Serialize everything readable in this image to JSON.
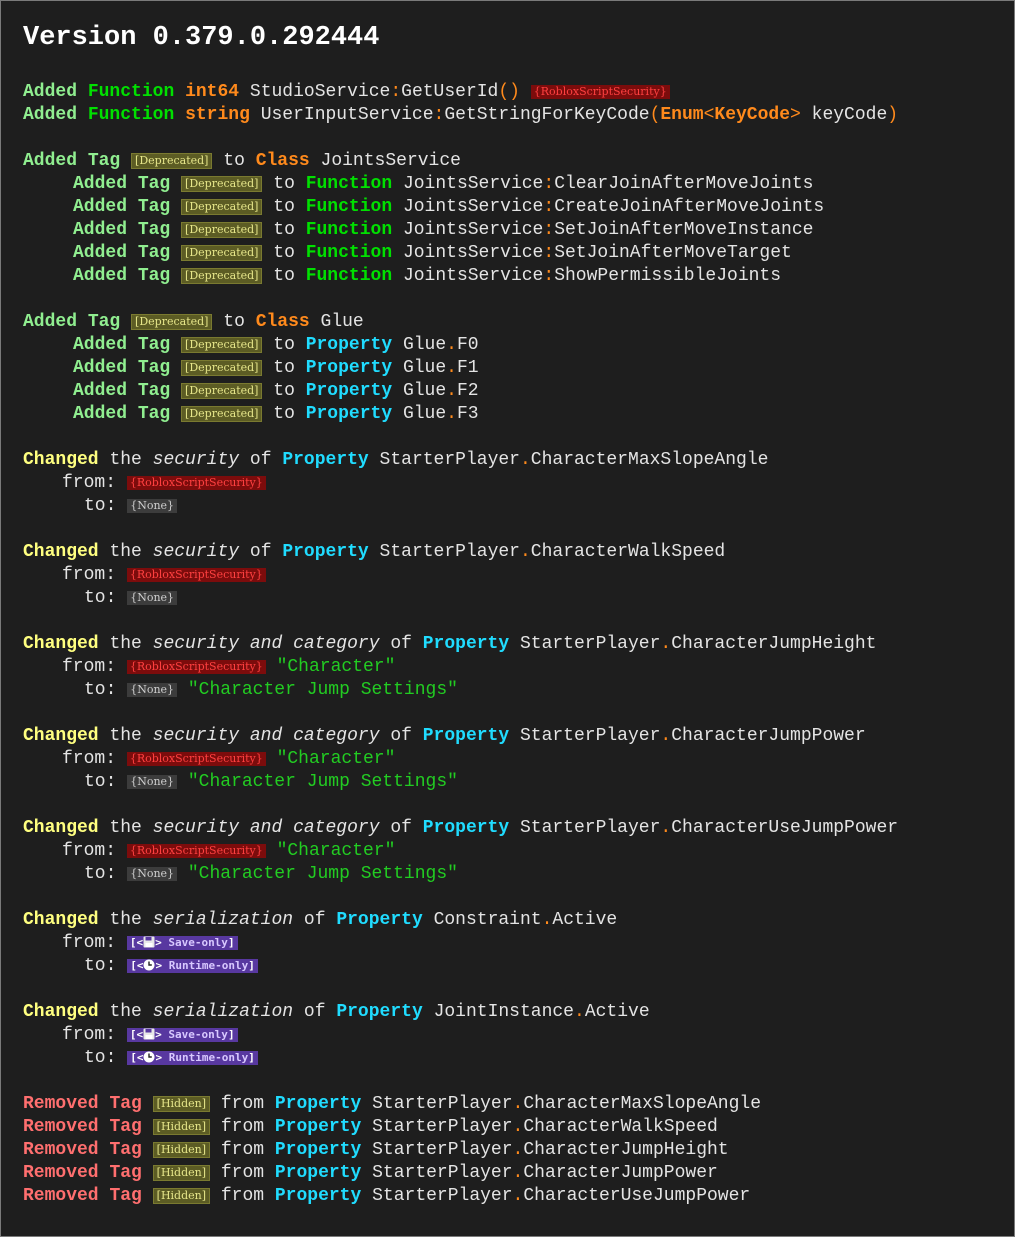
{
  "title": "Version 0.379.0.292444",
  "words": {
    "added": "Added",
    "changed": "Changed",
    "removed": "Removed",
    "tag": "Tag",
    "function": "Function",
    "class": "Class",
    "property": "Property",
    "to": "to",
    "from": "from",
    "of": "of",
    "the": "the",
    "from_label": "from:",
    "to_label": "to:",
    "security": "security",
    "security_and_category": "security and category",
    "serialization": "serialization"
  },
  "badges": {
    "deprecated": "[Deprecated]",
    "hidden": "[Hidden]",
    "rss": "{RobloxScriptSecurity}",
    "none": "{None}",
    "save_only": "Save-only",
    "runtime_only": "Runtime-only"
  },
  "functions": {
    "get_user_id": {
      "return_type": "int64",
      "owner": "StudioService",
      "name": "GetUserId",
      "security": "{RobloxScriptSecurity}"
    },
    "get_string_for_keycode": {
      "return_type": "string",
      "owner": "UserInputService",
      "name": "GetStringForKeyCode",
      "param_enum": "Enum",
      "param_type": "KeyCode",
      "param_name": "keyCode"
    }
  },
  "joints_service": {
    "class_name": "JointsService",
    "functions": [
      "ClearJoinAfterMoveJoints",
      "CreateJoinAfterMoveJoints",
      "SetJoinAfterMoveInstance",
      "SetJoinAfterMoveTarget",
      "ShowPermissibleJoints"
    ]
  },
  "glue": {
    "class_name": "Glue",
    "properties": [
      "F0",
      "F1",
      "F2",
      "F3"
    ]
  },
  "security_changes": [
    {
      "owner": "StarterPlayer",
      "name": "CharacterMaxSlopeAngle"
    },
    {
      "owner": "StarterPlayer",
      "name": "CharacterWalkSpeed"
    }
  ],
  "security_category_changes": [
    {
      "owner": "StarterPlayer",
      "name": "CharacterJumpHeight",
      "from_category": "\"Character\"",
      "to_category": "\"Character Jump Settings\""
    },
    {
      "owner": "StarterPlayer",
      "name": "CharacterJumpPower",
      "from_category": "\"Character\"",
      "to_category": "\"Character Jump Settings\""
    },
    {
      "owner": "StarterPlayer",
      "name": "CharacterUseJumpPower",
      "from_category": "\"Character\"",
      "to_category": "\"Character Jump Settings\""
    }
  ],
  "serialization_changes": [
    {
      "owner": "Constraint",
      "name": "Active"
    },
    {
      "owner": "JointInstance",
      "name": "Active"
    }
  ],
  "removed_hidden": [
    {
      "owner": "StarterPlayer",
      "name": "CharacterMaxSlopeAngle"
    },
    {
      "owner": "StarterPlayer",
      "name": "CharacterWalkSpeed"
    },
    {
      "owner": "StarterPlayer",
      "name": "CharacterJumpHeight"
    },
    {
      "owner": "StarterPlayer",
      "name": "CharacterJumpPower"
    },
    {
      "owner": "StarterPlayer",
      "name": "CharacterUseJumpPower"
    }
  ],
  "icons": {
    "save": "floppy-disk-icon",
    "runtime": "clock-icon"
  },
  "colors": {
    "background": "#1e1e1e",
    "added": "#90ee90",
    "changed": "#ffff80",
    "removed": "#ff6f6f",
    "function": "#00e000",
    "class": "#ff8a1c",
    "property": "#20dcff",
    "string": "#22cc22"
  }
}
